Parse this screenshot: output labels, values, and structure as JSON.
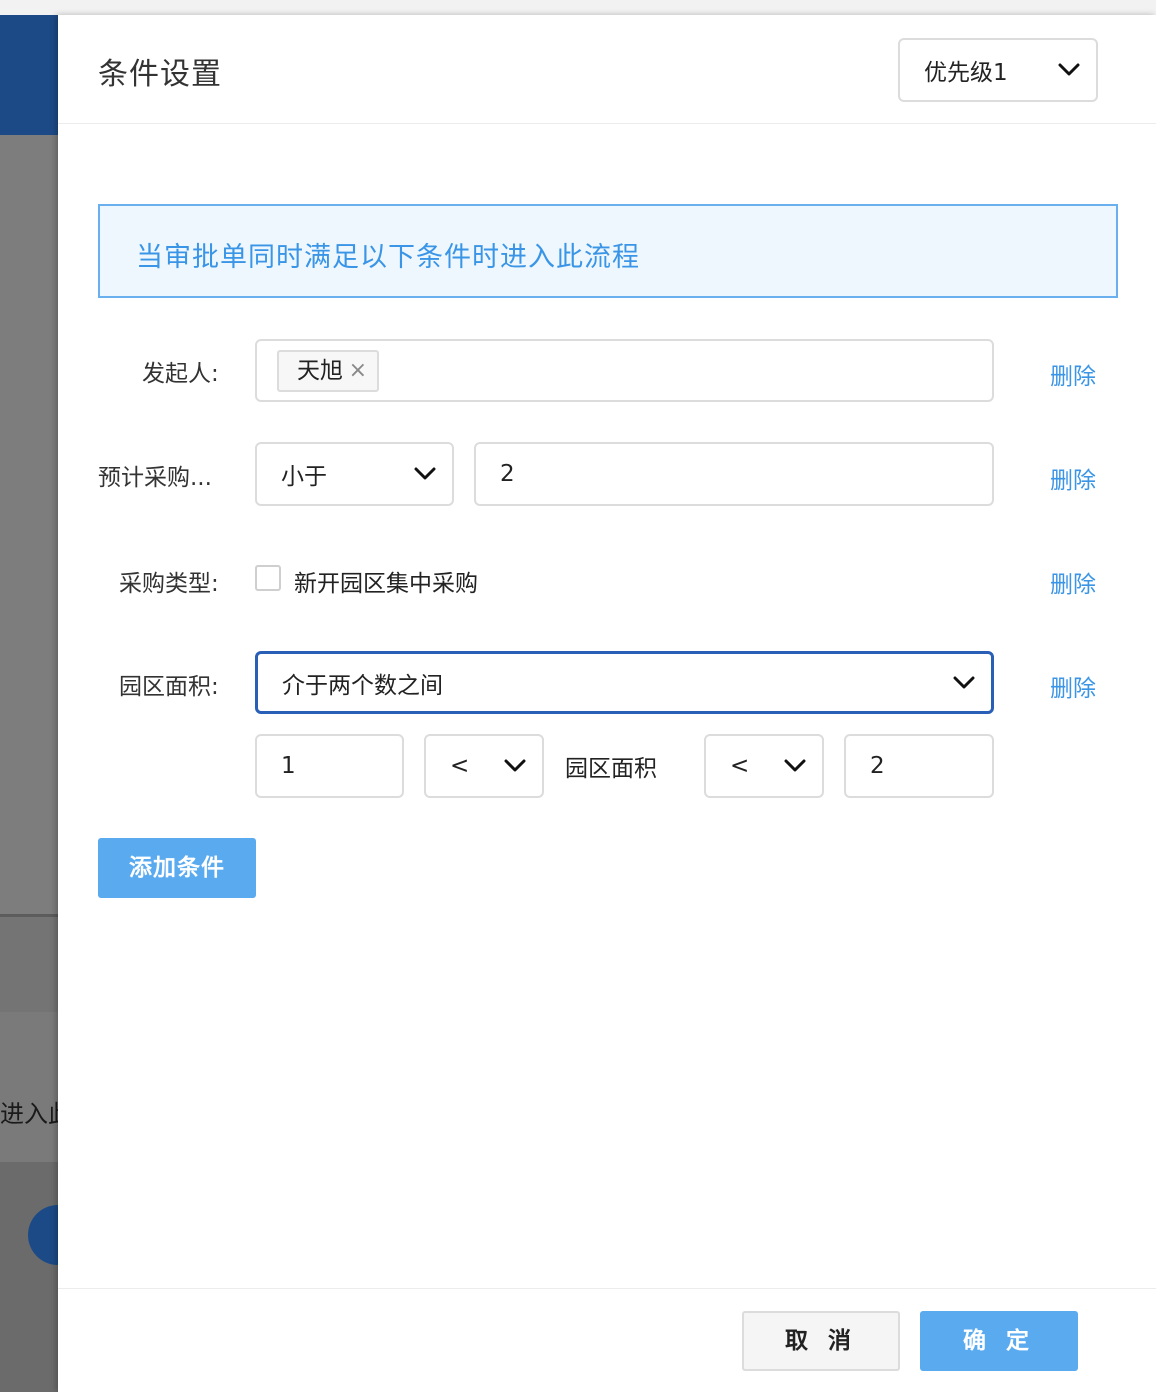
{
  "background": {
    "partial_text": "进入此"
  },
  "drawer": {
    "title": "条件设置",
    "priority": {
      "value": "优先级1"
    },
    "notice": "当审批单同时满足以下条件时进入此流程",
    "delete_label": "删除",
    "conditions": {
      "initiator": {
        "label": "发起人:",
        "tags": [
          "天旭"
        ],
        "tag_remove": "×"
      },
      "budget": {
        "label": "预计采购...",
        "operator": "小于",
        "value": "2"
      },
      "purchase_type": {
        "label": "采购类型:",
        "option": "新开园区集中采购",
        "checked": false
      },
      "park_area": {
        "label": "园区面积:",
        "mode": "介于两个数之间",
        "min": "1",
        "op1": "<",
        "field": "园区面积",
        "op2": "<",
        "max": "2"
      }
    },
    "add_condition": "添加条件",
    "footer": {
      "cancel": "取 消",
      "ok": "确 定"
    }
  },
  "colors": {
    "accent": "#5aaaf0",
    "link": "#3a95e6",
    "notice_bg": "#eef7fe",
    "focus_border": "#2a5fb8",
    "background_header": "#1c4a86"
  }
}
